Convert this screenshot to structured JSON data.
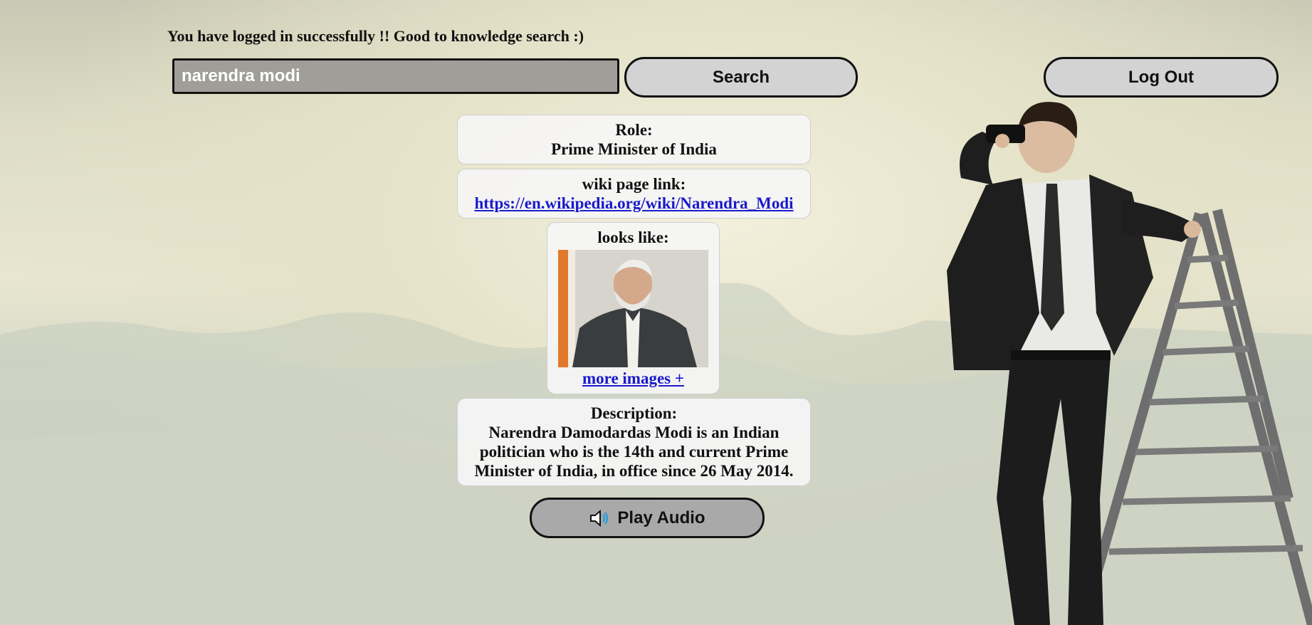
{
  "status_message": "You have logged in successfully !! Good to knowledge search :)",
  "search": {
    "value": "narendra modi",
    "button_label": "Search"
  },
  "logout_label": "Log Out",
  "result": {
    "role_heading": "Role:",
    "role_value": "Prime Minister of India",
    "wiki_heading": "wiki page link:",
    "wiki_url": "https://en.wikipedia.org/wiki/Narendra_Modi",
    "looks_heading": "looks like:",
    "more_images_label": "more images +",
    "description_heading": "Description:",
    "description_text": "Narendra Damodardas Modi is an Indian politician who is the 14th and current Prime Minister of India, in office since 26 May 2014."
  },
  "audio_button_label": "Play Audio",
  "icons": {
    "audio": "speaker-icon"
  },
  "colors": {
    "link": "#1a1acc",
    "button_bg": "#d3d3d3",
    "audio_button_bg": "#a9a9a9",
    "input_bg": "#a09e99"
  }
}
